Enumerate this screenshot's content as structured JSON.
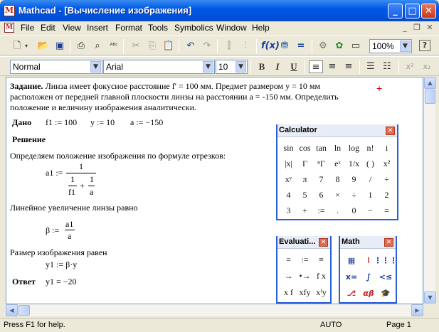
{
  "window": {
    "title": "Mathcad - [Вычисление изображения]",
    "app_icon": "M"
  },
  "menu": [
    "File",
    "Edit",
    "View",
    "Insert",
    "Format",
    "Tools",
    "Symbolics",
    "Window",
    "Help"
  ],
  "format_bar": {
    "style": "Normal",
    "font": "Arial",
    "size": "10"
  },
  "zoom": "100%",
  "doc": {
    "task_label": "Задание.",
    "task_line1": "Линза имеет фокусное расстояние f' = 100 мм. Предмет размером y = 10 мм",
    "task_line2": "расположен от передней главной плоскости линзы на расстоянии a = -150 мм. Определить",
    "task_line3": "положение и величину изображения аналитически.",
    "given_label": "Дано",
    "given_f1": "f1 := 100",
    "given_y": "y := 10",
    "given_a": "a := −150",
    "solution_label": "Решение",
    "step1_text": "Определяем положение изображения по формуле отрезков:",
    "a1_lhs": "a1 :=",
    "a1_num": "1",
    "a1_den1_num": "1",
    "a1_den1_den": "f1",
    "a1_plus": "+",
    "a1_den2_num": "1",
    "a1_den2_den": "a",
    "step2_text": "Линейное увеличение линзы равно",
    "beta_lhs": "β :=",
    "beta_num": "a1",
    "beta_den": "a",
    "step3_text": "Размер изображения равен",
    "y1_expr": "y1 := β·y",
    "answer_label": "Ответ",
    "answer_expr": "y1 = −20",
    "marker": "+"
  },
  "calculator": {
    "title": "Calculator",
    "rows": [
      [
        "sin",
        "cos",
        "tan",
        "ln",
        "log",
        "n!",
        "i"
      ],
      [
        "|x|",
        "Γ",
        "ⁿΓ",
        "eˣ",
        "1/x",
        "( )",
        "x²"
      ],
      [
        "xʸ",
        "π",
        "7",
        "8",
        "9",
        "/",
        "÷"
      ],
      [
        "4",
        "5",
        "6",
        "×",
        "÷",
        "1",
        "2"
      ],
      [
        "3",
        "+",
        ":=",
        ".",
        "0",
        "−",
        "="
      ]
    ]
  },
  "evaluation": {
    "title": "Evaluati...",
    "rows": [
      [
        "=",
        ":=",
        "≡"
      ],
      [
        "→",
        "•→",
        "f x"
      ],
      [
        "x f",
        "xfy",
        "xᶠy"
      ]
    ]
  },
  "math": {
    "title": "Math"
  },
  "status": {
    "help": "Press F1 for help.",
    "mode": "AUTO",
    "page": "Page 1"
  }
}
